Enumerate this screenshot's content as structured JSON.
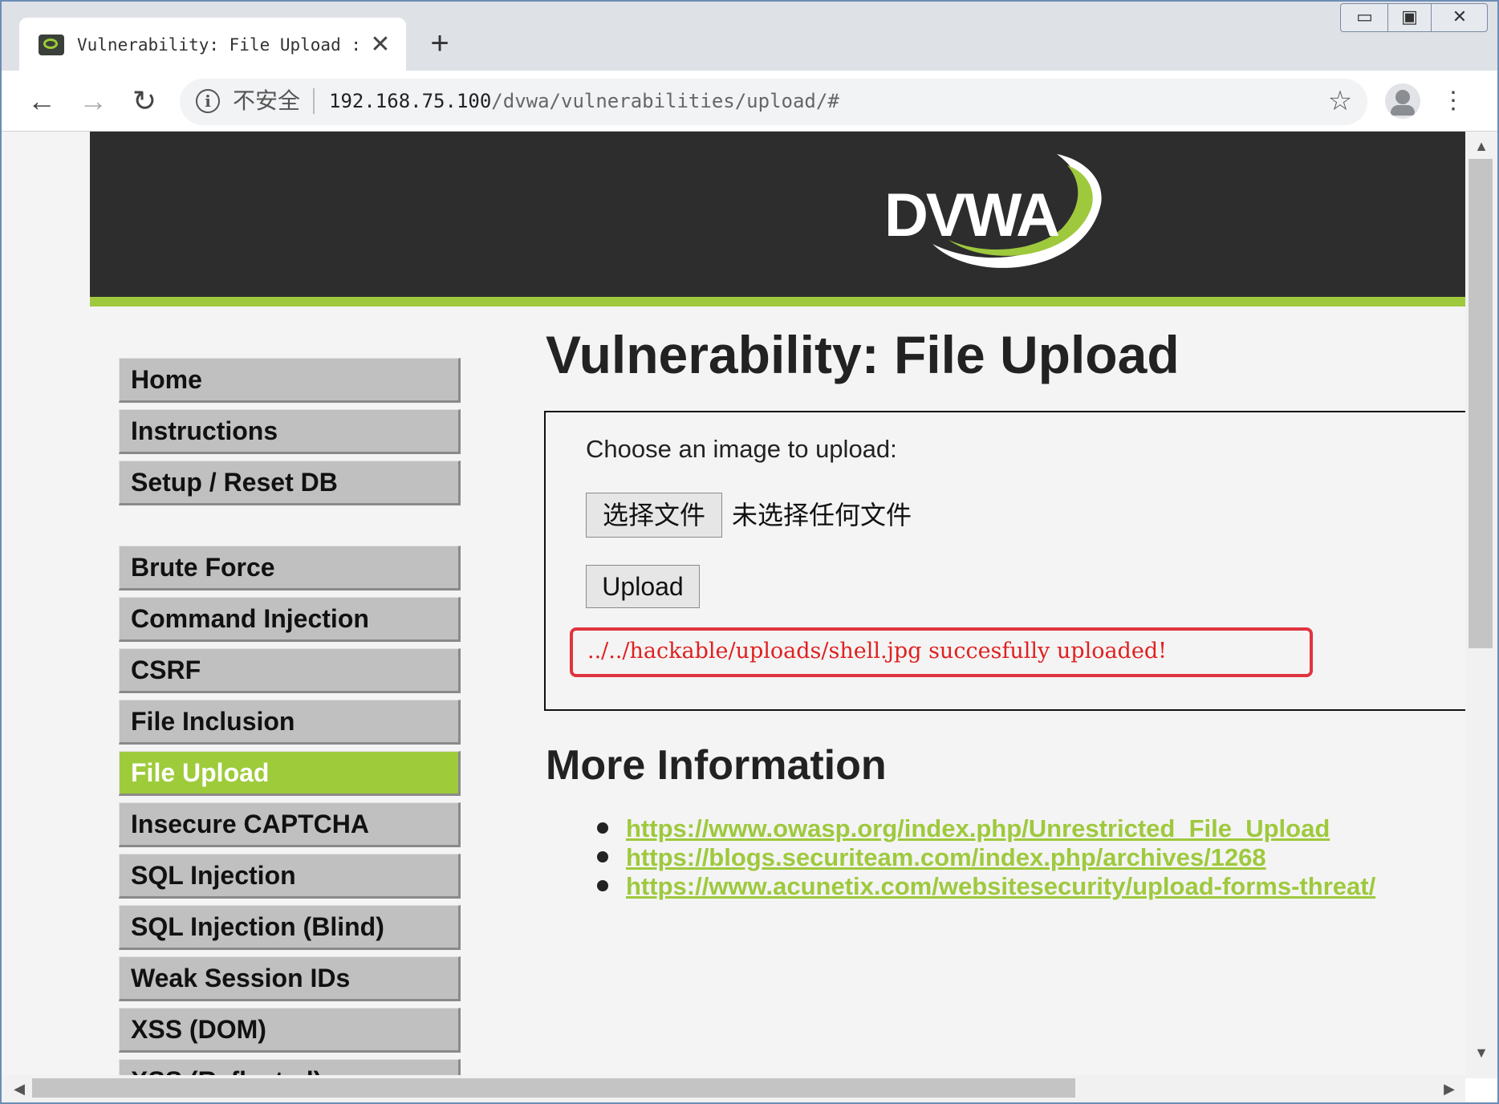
{
  "browser": {
    "tab_title": "Vulnerability: File Upload :: Damn Vulnerable Web Application (DVWA)",
    "tab_close": "✕",
    "new_tab": "+",
    "security_label": "不安全",
    "url_host": "192.168.75.100",
    "url_path": "/dvwa/vulnerabilities/upload/#",
    "back": "←",
    "forward": "→",
    "reload": "↻",
    "star": "☆",
    "menu": "⋮",
    "win_min": "▭",
    "win_max": "▣",
    "win_close": "✕"
  },
  "logo": {
    "text": "DVWA",
    "accent_color": "#9ec93d"
  },
  "sidebar": {
    "groups": [
      [
        "Home",
        "Instructions",
        "Setup / Reset DB"
      ],
      [
        "Brute Force",
        "Command Injection",
        "CSRF",
        "File Inclusion",
        "File Upload",
        "Insecure CAPTCHA",
        "SQL Injection",
        "SQL Injection (Blind)",
        "Weak Session IDs",
        "XSS (DOM)",
        "XSS (Reflected)"
      ]
    ],
    "active": "File Upload"
  },
  "main": {
    "title": "Vulnerability: File Upload",
    "upload_label": "Choose an image to upload:",
    "choose_file_button": "选择文件",
    "file_status": "未选择任何文件",
    "upload_button": "Upload",
    "result_message": "../../hackable/uploads/shell.jpg succesfully uploaded!",
    "more_info_title": "More Information",
    "links": [
      "https://www.owasp.org/index.php/Unrestricted_File_Upload",
      "https://blogs.securiteam.com/index.php/archives/1268",
      "https://www.acunetix.com/websitesecurity/upload-forms-threat/"
    ]
  },
  "colors": {
    "header_bg": "#2d2d2d",
    "accent_green": "#9ec93d",
    "error_red": "#e02020"
  }
}
